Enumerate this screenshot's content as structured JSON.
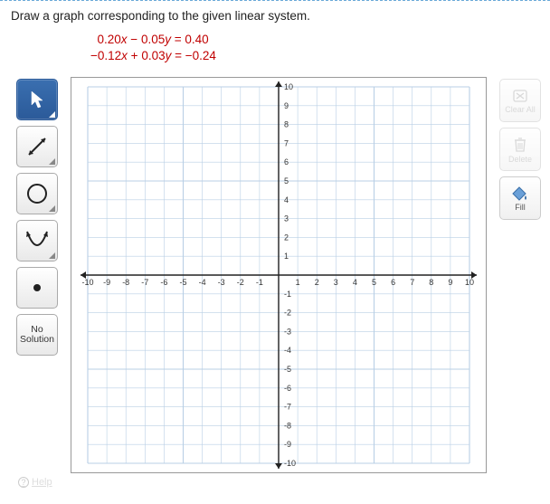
{
  "instruction": "Draw a graph corresponding to the given linear system.",
  "equations": {
    "eq1": {
      "lhs_a": "0.20",
      "var1": "x",
      "op1": " − ",
      "lhs_b": "0.05",
      "var2": "y",
      "eq": " = ",
      "rhs": "0.40"
    },
    "eq2": {
      "lhs_a": "−0.12",
      "var1": "x",
      "op1": " + ",
      "lhs_b": "0.03",
      "var2": "y",
      "eq": " = ",
      "rhs": "−0.24"
    }
  },
  "left_tools": {
    "pointer": "pointer",
    "line": "line",
    "circle": "circle",
    "curve": "parabola",
    "point": "point",
    "no_solution_line1": "No",
    "no_solution_line2": "Solution"
  },
  "right_tools": {
    "clear": "Clear All",
    "delete": "Delete",
    "fill": "Fill"
  },
  "help_label": "Help",
  "chart_data": {
    "type": "scatter",
    "x": [],
    "y": [],
    "xlabel": "",
    "ylabel": "",
    "xlim": [
      -10,
      10
    ],
    "ylim": [
      -10,
      10
    ],
    "xticks": [
      -10,
      -9,
      -8,
      -7,
      -6,
      -5,
      -4,
      -3,
      -2,
      -1,
      1,
      2,
      3,
      4,
      5,
      6,
      7,
      8,
      9,
      10
    ],
    "yticks": [
      -10,
      -9,
      -8,
      -7,
      -6,
      -5,
      -4,
      -3,
      -2,
      -1,
      1,
      2,
      3,
      4,
      5,
      6,
      7,
      8,
      9,
      10
    ],
    "grid": true
  }
}
